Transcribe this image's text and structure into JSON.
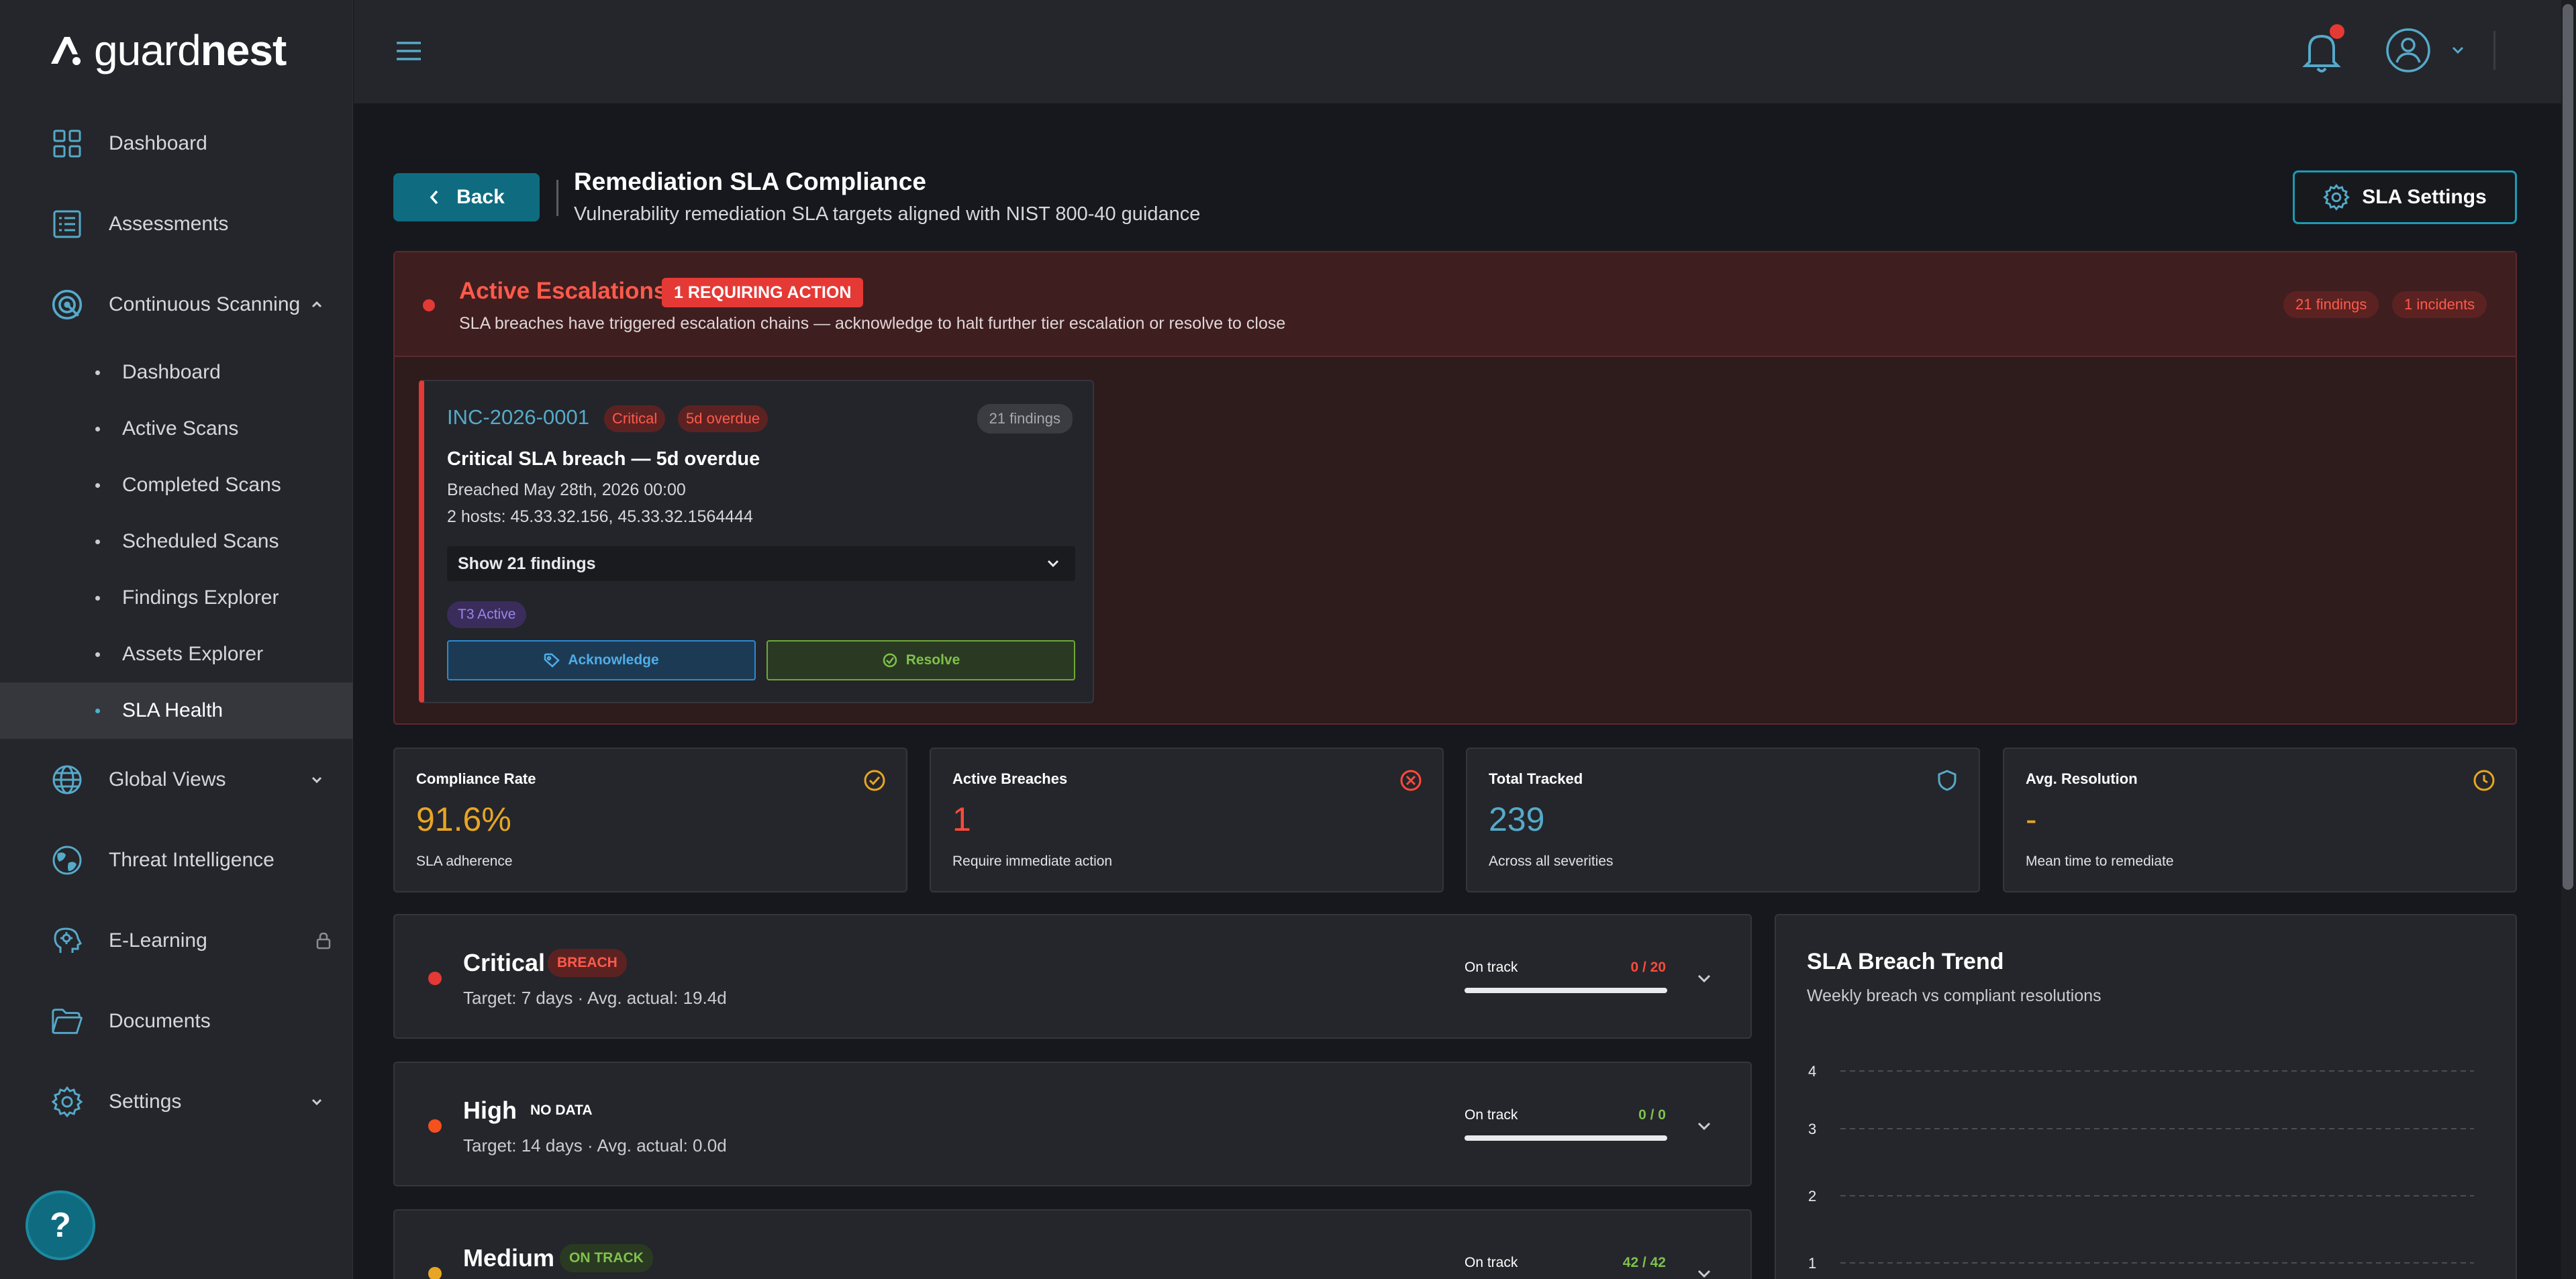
{
  "brand": {
    "name_light": "guard",
    "name_bold": "nest"
  },
  "sidebar": {
    "items": [
      {
        "label": "Dashboard",
        "icon": "grid-icon"
      },
      {
        "label": "Assessments",
        "icon": "list-icon"
      },
      {
        "label": "Continuous Scanning",
        "icon": "radar-icon"
      },
      {
        "label": "Global Views",
        "icon": "globe-icon"
      },
      {
        "label": "Threat Intelligence",
        "icon": "earth-icon"
      },
      {
        "label": "E-Learning",
        "icon": "brain-icon"
      },
      {
        "label": "Documents",
        "icon": "folder-icon"
      },
      {
        "label": "Settings",
        "icon": "gear-icon"
      }
    ],
    "sub_items": [
      "Dashboard",
      "Active Scans",
      "Completed Scans",
      "Scheduled Scans",
      "Findings Explorer",
      "Assets Explorer",
      "SLA Health"
    ],
    "active_sub": "SLA Health",
    "help": "?"
  },
  "header": {
    "back": "Back",
    "title": "Remediation SLA Compliance",
    "subtitle": "Vulnerability remediation SLA targets aligned with NIST 800-40 guidance",
    "settings": "SLA Settings"
  },
  "escalations": {
    "title": "Active Escalations",
    "badge": "1 REQUIRING ACTION",
    "description": "SLA breaches have triggered escalation chains — acknowledge to halt further tier escalation or resolve to close",
    "findings_pill": "21 findings",
    "incidents_pill": "1 incidents",
    "incident": {
      "id": "INC-2026-0001",
      "severity": "Critical",
      "overdue": "5d overdue",
      "findings": "21 findings",
      "title": "Critical SLA breach — 5d overdue",
      "breached": "Breached May 28th, 2026 00:00",
      "hosts": "2 hosts: 45.33.32.156, 45.33.32.1564444",
      "show_findings": "Show 21 findings",
      "tier": "T3 Active",
      "acknowledge": "Acknowledge",
      "resolve": "Resolve"
    }
  },
  "stats": [
    {
      "label": "Compliance Rate",
      "value": "91.6%",
      "sub": "SLA adherence",
      "color": "#e8a524",
      "icon": "check-circle-icon"
    },
    {
      "label": "Active Breaches",
      "value": "1",
      "sub": "Require immediate action",
      "color": "#ff4a3a",
      "icon": "x-circle-icon"
    },
    {
      "label": "Total Tracked",
      "value": "239",
      "sub": "Across all severities",
      "color": "#56a9c9",
      "icon": "shield-icon"
    },
    {
      "label": "Avg. Resolution",
      "value": "-",
      "sub": "Mean time to remediate",
      "color": "#e8a524",
      "icon": "clock-icon"
    }
  ],
  "severities": [
    {
      "name": "Critical",
      "tag": "BREACH",
      "target": "Target: 7 days · Avg. actual: 19.4d",
      "ontrack": "On track",
      "ratio": "0 / 20",
      "dot": "#e53935",
      "ratio_color": "#ff4a3a",
      "progress": 0
    },
    {
      "name": "High",
      "tag": "NO DATA",
      "target": "Target: 14 days · Avg. actual: 0.0d",
      "ontrack": "On track",
      "ratio": "0 / 0",
      "dot": "#f4511e",
      "ratio_color": "#7fc14c",
      "progress": 0
    },
    {
      "name": "Medium",
      "tag": "ON TRACK",
      "target": "",
      "ontrack": "On track",
      "ratio": "42 / 42",
      "dot": "#e8a524",
      "ratio_color": "#7fc14c",
      "progress": 1
    }
  ],
  "trend": {
    "title": "SLA Breach Trend",
    "subtitle": "Weekly breach vs compliant resolutions"
  },
  "chart_data": {
    "type": "line",
    "title": "SLA Breach Trend",
    "subtitle": "Weekly breach vs compliant resolutions",
    "y_ticks": [
      "4",
      "3",
      "2",
      "1"
    ],
    "grid": true
  }
}
